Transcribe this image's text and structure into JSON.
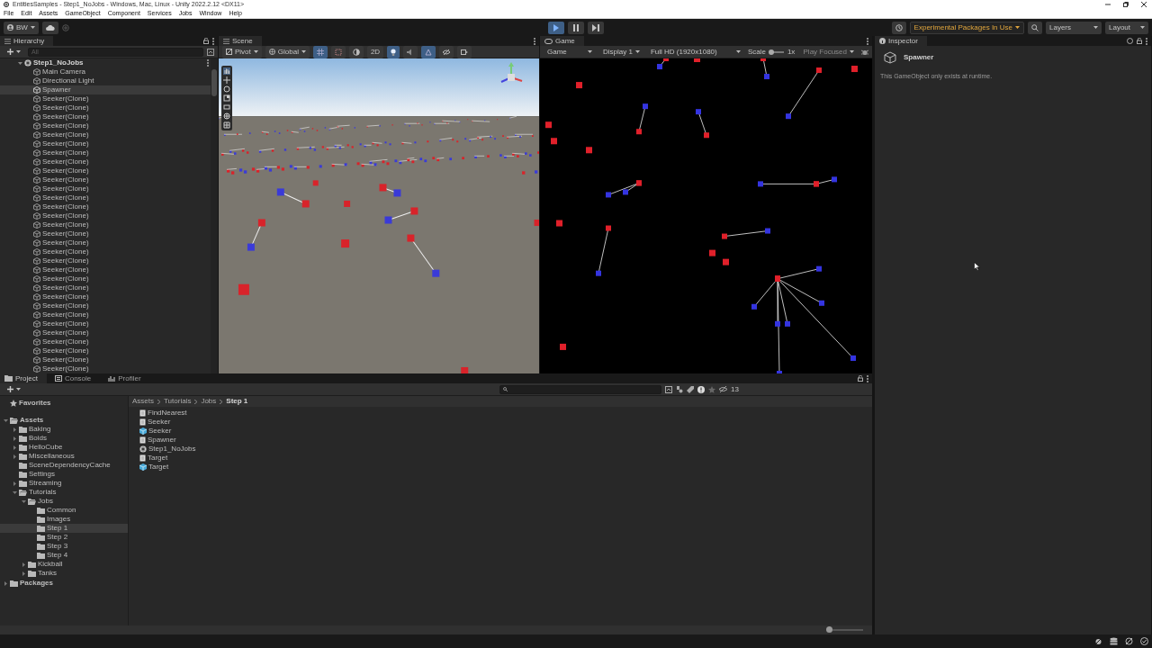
{
  "window": {
    "title": "EntitiesSamples - Step1_NoJobs - Windows, Mac, Linux - Unity 2022.2.12 <DX11>"
  },
  "menu": [
    "File",
    "Edit",
    "Assets",
    "GameObject",
    "Component",
    "Services",
    "Jobs",
    "Window",
    "Help"
  ],
  "toolbar": {
    "account": "BW",
    "play_controls": [
      {
        "kind": "play",
        "on": true
      },
      {
        "kind": "pause",
        "on": false
      },
      {
        "kind": "step",
        "on": false
      }
    ],
    "packages_notice": "Experimental Packages In Use",
    "layers": "Layers",
    "layout": "Layout"
  },
  "hierarchy": {
    "title": "Hierarchy",
    "search": {
      "placeholder": "All"
    },
    "scene": {
      "name": "Step1_NoJobs",
      "expanded": true,
      "children": [
        {
          "name": "Main Camera",
          "selected": false
        },
        {
          "name": "Directional Light",
          "selected": false
        },
        {
          "name": "Spawner",
          "selected": true
        },
        {
          "name": "Seeker(Clone)",
          "selected": false
        },
        {
          "name": "Seeker(Clone)",
          "selected": false
        },
        {
          "name": "Seeker(Clone)",
          "selected": false
        },
        {
          "name": "Seeker(Clone)",
          "selected": false
        },
        {
          "name": "Seeker(Clone)",
          "selected": false
        },
        {
          "name": "Seeker(Clone)",
          "selected": false
        },
        {
          "name": "Seeker(Clone)",
          "selected": false
        },
        {
          "name": "Seeker(Clone)",
          "selected": false
        },
        {
          "name": "Seeker(Clone)",
          "selected": false
        },
        {
          "name": "Seeker(Clone)",
          "selected": false
        },
        {
          "name": "Seeker(Clone)",
          "selected": false
        },
        {
          "name": "Seeker(Clone)",
          "selected": false
        },
        {
          "name": "Seeker(Clone)",
          "selected": false
        },
        {
          "name": "Seeker(Clone)",
          "selected": false
        },
        {
          "name": "Seeker(Clone)",
          "selected": false
        },
        {
          "name": "Seeker(Clone)",
          "selected": false
        },
        {
          "name": "Seeker(Clone)",
          "selected": false
        },
        {
          "name": "Seeker(Clone)",
          "selected": false
        },
        {
          "name": "Seeker(Clone)",
          "selected": false
        },
        {
          "name": "Seeker(Clone)",
          "selected": false
        },
        {
          "name": "Seeker(Clone)",
          "selected": false
        },
        {
          "name": "Seeker(Clone)",
          "selected": false
        },
        {
          "name": "Seeker(Clone)",
          "selected": false
        },
        {
          "name": "Seeker(Clone)",
          "selected": false
        },
        {
          "name": "Seeker(Clone)",
          "selected": false
        },
        {
          "name": "Seeker(Clone)",
          "selected": false
        },
        {
          "name": "Seeker(Clone)",
          "selected": false
        },
        {
          "name": "Seeker(Clone)",
          "selected": false
        },
        {
          "name": "Seeker(Clone)",
          "selected": false
        },
        {
          "name": "Seeker(Clone)",
          "selected": false
        },
        {
          "name": "Seeker(Clone)",
          "selected": false
        }
      ]
    }
  },
  "scene_view": {
    "title": "Scene",
    "pivot": "Pivot",
    "space": "Global",
    "mode_2d": "2D",
    "lighting": {
      "on": true
    }
  },
  "game_view": {
    "title": "Game",
    "view": "Game",
    "display": "Display 1",
    "resolution": "Full HD (1920x1080)",
    "scale_label": "Scale",
    "scale": {
      "level": 0.15
    },
    "scale_value": "1x",
    "play_mode": "Play Focused"
  },
  "inspector": {
    "title": "Inspector",
    "object": "Spawner",
    "message": "This GameObject only exists at runtime."
  },
  "bottom_tabs": [
    {
      "label": "Project",
      "selected": true
    },
    {
      "label": "Console",
      "selected": false
    },
    {
      "label": "Profiler",
      "selected": false
    }
  ],
  "project": {
    "hidden_count": "13",
    "tree": [
      {
        "name": "Favorites",
        "kind": "favorites",
        "selected": false
      },
      {
        "name": "Assets",
        "kind": "folder",
        "expanded": true,
        "selected": false,
        "children": [
          {
            "name": "Baking",
            "expanded": false,
            "selected": false
          },
          {
            "name": "Boids",
            "expanded": false,
            "selected": false
          },
          {
            "name": "HelloCube",
            "expanded": false,
            "selected": false
          },
          {
            "name": "Miscellaneous",
            "expanded": false,
            "selected": false
          },
          {
            "name": "SceneDependencyCache",
            "selected": false
          },
          {
            "name": "Settings",
            "selected": false
          },
          {
            "name": "Streaming",
            "expanded": false,
            "selected": false
          },
          {
            "name": "Tutorials",
            "expanded": true,
            "selected": false,
            "children": [
              {
                "name": "Jobs",
                "expanded": true,
                "selected": false,
                "children": [
                  {
                    "name": "Common",
                    "selected": false
                  },
                  {
                    "name": "Images",
                    "selected": false
                  },
                  {
                    "name": "Step 1",
                    "selected": true
                  },
                  {
                    "name": "Step 2",
                    "selected": false
                  },
                  {
                    "name": "Step 3",
                    "selected": false
                  },
                  {
                    "name": "Step 4",
                    "selected": false
                  }
                ]
              },
              {
                "name": "Kickball",
                "expanded": false,
                "selected": false
              },
              {
                "name": "Tanks",
                "expanded": false,
                "selected": false
              }
            ]
          }
        ]
      },
      {
        "name": "Packages",
        "kind": "folder",
        "expanded": false,
        "selected": false
      }
    ],
    "breadcrumb": [
      "Assets",
      "Tutorials",
      "Jobs",
      "Step 1"
    ],
    "assets": [
      {
        "name": "FindNearest",
        "kind": "script"
      },
      {
        "name": "Seeker",
        "kind": "script"
      },
      {
        "name": "Seeker",
        "kind": "prefab"
      },
      {
        "name": "Spawner",
        "kind": "script"
      },
      {
        "name": "Step1_NoJobs",
        "kind": "scene"
      },
      {
        "name": "Target",
        "kind": "script"
      },
      {
        "name": "Target",
        "kind": "prefab"
      }
    ],
    "zoom": {
      "level": 0
    }
  }
}
